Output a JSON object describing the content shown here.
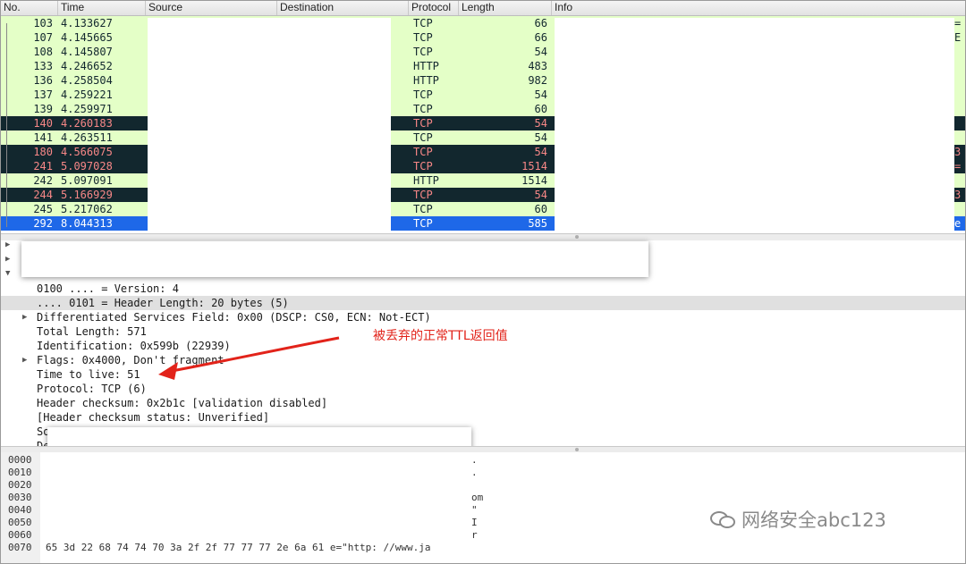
{
  "columns": {
    "no": "No.",
    "time": "Time",
    "source": "Source",
    "destination": "Destination",
    "protocol": "Protocol",
    "length": "Length",
    "info": "Info"
  },
  "packets": [
    {
      "no": "103",
      "time": "4.133627",
      "protocol": "TCP",
      "length": "66",
      "style": "green",
      "info_tail": "="
    },
    {
      "no": "107",
      "time": "4.145665",
      "protocol": "TCP",
      "length": "66",
      "style": "green",
      "info_tail": "E"
    },
    {
      "no": "108",
      "time": "4.145807",
      "protocol": "TCP",
      "length": "54",
      "style": "green",
      "info_tail": ""
    },
    {
      "no": "133",
      "time": "4.246652",
      "protocol": "HTTP",
      "length": "483",
      "style": "green",
      "info_tail": ""
    },
    {
      "no": "136",
      "time": "4.258504",
      "protocol": "HTTP",
      "length": "982",
      "style": "green",
      "info_tail": ""
    },
    {
      "no": "137",
      "time": "4.259221",
      "protocol": "TCP",
      "length": "54",
      "style": "green",
      "info_tail": ""
    },
    {
      "no": "139",
      "time": "4.259971",
      "protocol": "TCP",
      "length": "60",
      "style": "green",
      "info_tail": ""
    },
    {
      "no": "140",
      "time": "4.260183",
      "protocol": "TCP",
      "length": "54",
      "style": "dark",
      "info_tail": ""
    },
    {
      "no": "141",
      "time": "4.263511",
      "protocol": "TCP",
      "length": "54",
      "style": "green",
      "info_tail": ""
    },
    {
      "no": "180",
      "time": "4.566075",
      "protocol": "TCP",
      "length": "54",
      "style": "dark",
      "info_tail": "3"
    },
    {
      "no": "241",
      "time": "5.097028",
      "protocol": "TCP",
      "length": "1514",
      "style": "dark",
      "info_tail": "="
    },
    {
      "no": "242",
      "time": "5.097091",
      "protocol": "HTTP",
      "length": "1514",
      "style": "green",
      "info_tail": ""
    },
    {
      "no": "244",
      "time": "5.166929",
      "protocol": "TCP",
      "length": "54",
      "style": "dark",
      "info_tail": "3"
    },
    {
      "no": "245",
      "time": "5.217062",
      "protocol": "TCP",
      "length": "60",
      "style": "green",
      "info_tail": ""
    },
    {
      "no": "292",
      "time": "8.044313",
      "protocol": "TCP",
      "length": "585",
      "style": "sel",
      "info_tail": "e"
    }
  ],
  "details": [
    {
      "text": "0100 .... = Version: 4",
      "toggle": false,
      "hl": false
    },
    {
      "text": ".... 0101 = Header Length: 20 bytes (5)",
      "toggle": false,
      "hl": true
    },
    {
      "text": "Differentiated Services Field: 0x00 (DSCP: CS0, ECN: Not-ECT)",
      "toggle": true,
      "hl": false
    },
    {
      "text": "Total Length: 571",
      "toggle": false,
      "hl": false
    },
    {
      "text": "Identification: 0x599b (22939)",
      "toggle": false,
      "hl": false
    },
    {
      "text": "Flags: 0x4000, Don't fragment",
      "toggle": true,
      "hl": false
    },
    {
      "text": "Time to live: 51",
      "toggle": false,
      "hl": false
    },
    {
      "text": "Protocol: TCP (6)",
      "toggle": false,
      "hl": false
    },
    {
      "text": "Header checksum: 0x2b1c [validation disabled]",
      "toggle": false,
      "hl": false
    },
    {
      "text": "[Header checksum status: Unverified]",
      "toggle": false,
      "hl": false
    },
    {
      "text": "So",
      "toggle": false,
      "hl": false
    },
    {
      "text": "De",
      "toggle": false,
      "hl": false
    }
  ],
  "annotation": "被丢弃的正常TTL返回值",
  "hex_offsets": [
    "0000",
    "0010",
    "0020",
    "0030",
    "0040",
    "0050",
    "0060",
    "0070"
  ],
  "hex_last_line": "65 3d 22 68 74 74 70 3a  2f 2f 77 77 77 2e 6a 61   e=\"http: //www.ja",
  "hex_ascii_tails": [
    ".",
    ".",
    "",
    "om",
    "\"",
    "I",
    "r",
    ""
  ],
  "watermark": "网络安全abc123",
  "colors": {
    "green_row": "#e4ffc7",
    "dark_row": "#12272e",
    "dark_row_text": "#f78787",
    "selected_row": "#1e68e8",
    "annotation": "#e2231a"
  }
}
